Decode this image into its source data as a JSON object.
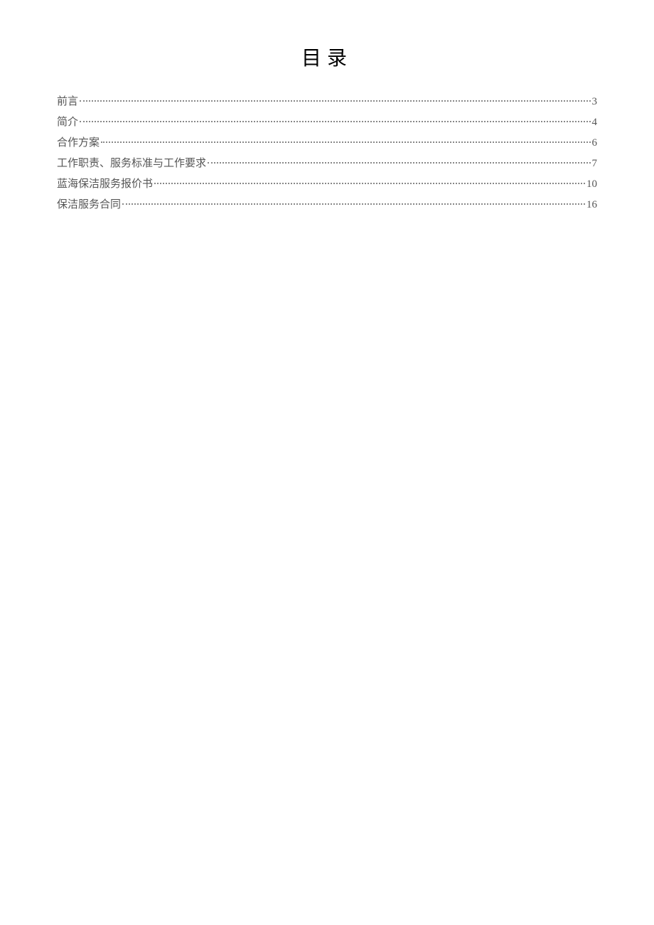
{
  "title": "目录",
  "toc": {
    "entries": [
      {
        "label": "前言",
        "page": "3"
      },
      {
        "label": "简介",
        "page": "4"
      },
      {
        "label": "合作方案",
        "page": "6"
      },
      {
        "label": "工作职责、服务标准与工作要求",
        "page": "7"
      },
      {
        "label": "蓝海保洁服务报价书",
        "page": "10"
      },
      {
        "label": "保洁服务合同",
        "page": "16"
      }
    ]
  }
}
